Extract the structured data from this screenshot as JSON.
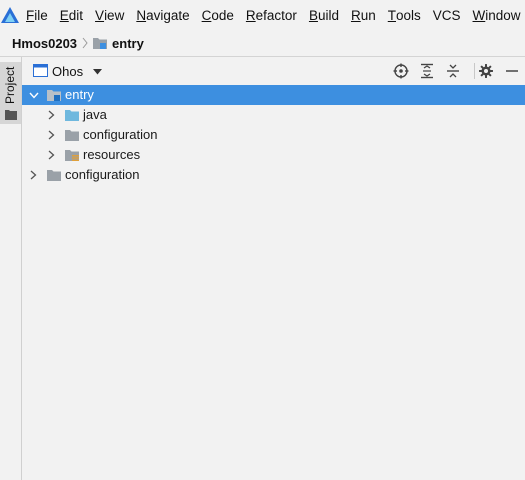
{
  "menubar": {
    "items": [
      {
        "mnemonic": "F",
        "rest": "ile"
      },
      {
        "mnemonic": "E",
        "rest": "dit"
      },
      {
        "mnemonic": "V",
        "rest": "iew"
      },
      {
        "mnemonic": "N",
        "rest": "avigate"
      },
      {
        "mnemonic": "C",
        "rest": "ode"
      },
      {
        "mnemonic": "R",
        "rest": "efactor"
      },
      {
        "mnemonic": "B",
        "rest": "uild"
      },
      {
        "mnemonic": "R",
        "rest": "un"
      },
      {
        "mnemonic": "T",
        "rest": "ools"
      },
      {
        "mnemonic": "",
        "rest": "VCS"
      },
      {
        "mnemonic": "W",
        "rest": "indow"
      }
    ]
  },
  "breadcrumb": {
    "project": "Hmos0203",
    "module": "entry"
  },
  "toolstrip": {
    "project_tab": "Project"
  },
  "panel": {
    "view_selector": "Ohos"
  },
  "tree": [
    {
      "label": "entry",
      "expanded": true,
      "selected": true,
      "icon": "module-folder-icon"
    },
    {
      "label": "java",
      "expanded": false,
      "selected": false,
      "icon": "source-folder-icon"
    },
    {
      "label": "configuration",
      "expanded": false,
      "selected": false,
      "icon": "folder-icon"
    },
    {
      "label": "resources",
      "expanded": false,
      "selected": false,
      "icon": "resources-folder-icon"
    },
    {
      "label": "configuration",
      "expanded": false,
      "selected": false,
      "icon": "folder-icon"
    }
  ],
  "colors": {
    "selection": "#3d8fe0",
    "background": "#f2f2f2",
    "folder_gray": "#9aa1a8",
    "source_folder_blue": "#6fb8de",
    "module_marker_blue": "#3d8fe0",
    "resources_marker_orange": "#e0a03a",
    "logo_blue": "#2a6fd6"
  }
}
